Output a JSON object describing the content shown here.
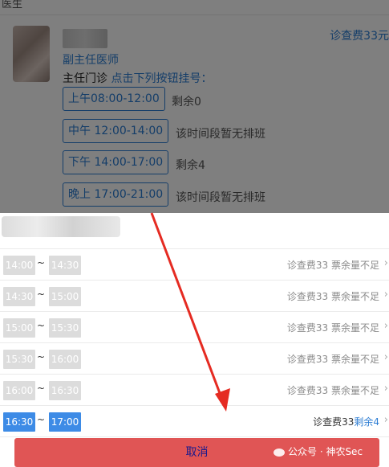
{
  "background_page": {
    "top_cut_text": "医生",
    "fee": "诊查费33元",
    "doctor_title": "副主任医师",
    "clinic_label": "主任门诊",
    "clinic_instruction": "点击下列按钮挂号：",
    "slots": [
      {
        "label": "上午08:00-12:00",
        "note": "剩余0"
      },
      {
        "label": "中午 12:00-14:00",
        "note": "该时间段暂无排班"
      },
      {
        "label": "下午 14:00-17:00",
        "note": "剩余4"
      },
      {
        "label": "晚上 17:00-21:00",
        "note": "该时间段暂无排班"
      }
    ]
  },
  "sheet": {
    "rows": [
      {
        "start": "14:00",
        "end": "14:30",
        "info": "诊查费33 票余量不足",
        "active": false
      },
      {
        "start": "14:30",
        "end": "15:00",
        "info": "诊查费33 票余量不足",
        "active": false
      },
      {
        "start": "15:00",
        "end": "15:30",
        "info": "诊查费33 票余量不足",
        "active": false
      },
      {
        "start": "15:30",
        "end": "16:00",
        "info": "诊查费33 票余量不足",
        "active": false
      },
      {
        "start": "16:00",
        "end": "16:30",
        "info": "诊查费33 票余量不足",
        "active": false
      },
      {
        "start": "16:30",
        "end": "17:00",
        "info": "诊查费33",
        "remain": "剩余4",
        "active": true
      }
    ],
    "tilde": "~",
    "chevron": "›",
    "cancel_label": "取消"
  },
  "watermark": "公众号 · 神农Sec",
  "colors": {
    "accent": "#2b7cd3",
    "active_slot": "#3d8be6",
    "cancel": "#e05555",
    "arrow": "#e52b22"
  }
}
